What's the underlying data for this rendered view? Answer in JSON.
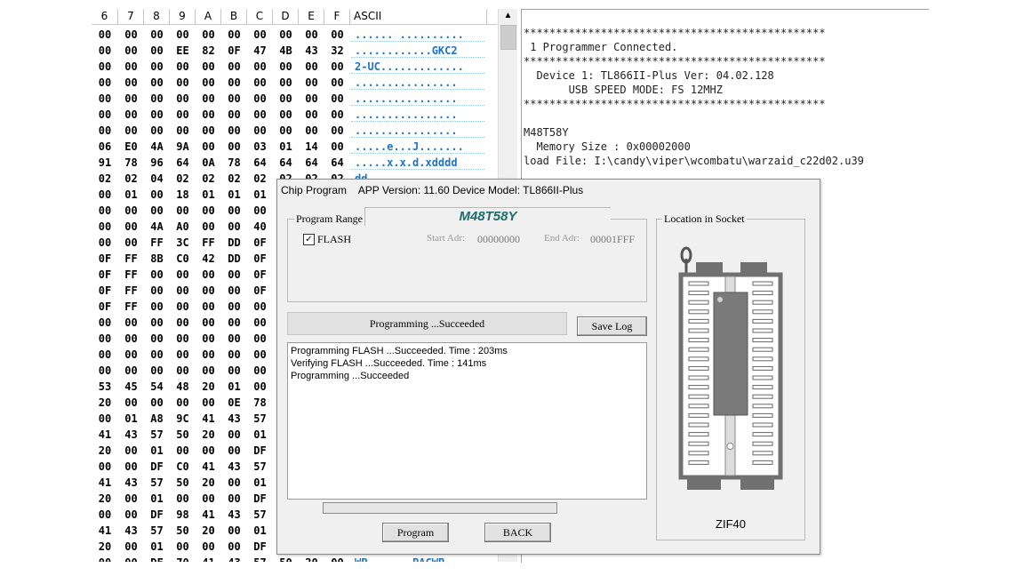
{
  "hex_view": {
    "columns": [
      "6",
      "7",
      "8",
      "9",
      "A",
      "B",
      "C",
      "D",
      "E",
      "F"
    ],
    "ascii_header": "ASCII",
    "rows": [
      {
        "cells": [
          "00",
          "00",
          "00",
          "00",
          "00",
          "00",
          "00",
          "00",
          "00",
          "00"
        ],
        "ascii": "...... .........."
      },
      {
        "cells": [
          "00",
          "00",
          "00",
          "EE",
          "82",
          "0F",
          "47",
          "4B",
          "43",
          "32"
        ],
        "ascii": "............GKC2"
      },
      {
        "cells": [
          "00",
          "00",
          "00",
          "00",
          "00",
          "00",
          "00",
          "00",
          "00",
          "00"
        ],
        "ascii": "2-UC............."
      },
      {
        "cells": [
          "00",
          "00",
          "00",
          "00",
          "00",
          "00",
          "00",
          "00",
          "00",
          "00"
        ],
        "ascii": "................"
      },
      {
        "cells": [
          "00",
          "00",
          "00",
          "00",
          "00",
          "00",
          "00",
          "00",
          "00",
          "00"
        ],
        "ascii": "................"
      },
      {
        "cells": [
          "00",
          "00",
          "00",
          "00",
          "00",
          "00",
          "00",
          "00",
          "00",
          "00"
        ],
        "ascii": "................"
      },
      {
        "cells": [
          "00",
          "00",
          "00",
          "00",
          "00",
          "00",
          "00",
          "00",
          "00",
          "00"
        ],
        "ascii": "................"
      },
      {
        "cells": [
          "06",
          "E0",
          "4A",
          "9A",
          "00",
          "00",
          "03",
          "01",
          "14",
          "00"
        ],
        "ascii": ".....e...J......."
      },
      {
        "cells": [
          "91",
          "78",
          "96",
          "64",
          "0A",
          "78",
          "64",
          "64",
          "64",
          "64"
        ],
        "ascii": ".....x.x.d.xdddd"
      },
      {
        "cells": [
          "02",
          "02",
          "04",
          "02",
          "02",
          "02",
          "02",
          "02",
          "02",
          "02"
        ],
        "ascii": "dd"
      },
      {
        "cells": [
          "00",
          "01",
          "00",
          "18",
          "01",
          "01",
          "01",
          "",
          "",
          ""
        ],
        "ascii": ""
      },
      {
        "cells": [
          "00",
          "00",
          "00",
          "00",
          "00",
          "00",
          "00",
          "",
          "",
          ""
        ],
        "ascii": ""
      },
      {
        "cells": [
          "00",
          "00",
          "4A",
          "A0",
          "00",
          "00",
          "40",
          "",
          "",
          ""
        ],
        "ascii": ""
      },
      {
        "cells": [
          "00",
          "00",
          "FF",
          "3C",
          "FF",
          "DD",
          "0F",
          "",
          "",
          ""
        ],
        "ascii": ""
      },
      {
        "cells": [
          "0F",
          "FF",
          "8B",
          "C0",
          "42",
          "DD",
          "0F",
          "",
          "",
          ""
        ],
        "ascii": ""
      },
      {
        "cells": [
          "0F",
          "FF",
          "00",
          "00",
          "00",
          "00",
          "0F",
          "",
          "",
          ""
        ],
        "ascii": ""
      },
      {
        "cells": [
          "0F",
          "FF",
          "00",
          "00",
          "00",
          "00",
          "0F",
          "",
          "",
          ""
        ],
        "ascii": ""
      },
      {
        "cells": [
          "0F",
          "FF",
          "00",
          "00",
          "00",
          "00",
          "00",
          "",
          "",
          ""
        ],
        "ascii": ""
      },
      {
        "cells": [
          "00",
          "00",
          "00",
          "00",
          "00",
          "00",
          "00",
          "",
          "",
          ""
        ],
        "ascii": ""
      },
      {
        "cells": [
          "00",
          "00",
          "00",
          "00",
          "00",
          "00",
          "00",
          "",
          "",
          ""
        ],
        "ascii": ""
      },
      {
        "cells": [
          "00",
          "00",
          "00",
          "00",
          "00",
          "00",
          "00",
          "",
          "",
          ""
        ],
        "ascii": ""
      },
      {
        "cells": [
          "00",
          "00",
          "00",
          "00",
          "00",
          "00",
          "00",
          "",
          "",
          ""
        ],
        "ascii": ""
      },
      {
        "cells": [
          "53",
          "45",
          "54",
          "48",
          "20",
          "01",
          "00",
          "",
          "",
          ""
        ],
        "ascii": ""
      },
      {
        "cells": [
          "20",
          "00",
          "00",
          "00",
          "00",
          "0E",
          "78",
          "",
          "",
          ""
        ],
        "ascii": ""
      },
      {
        "cells": [
          "00",
          "01",
          "A8",
          "9C",
          "41",
          "43",
          "57",
          "",
          "",
          ""
        ],
        "ascii": ""
      },
      {
        "cells": [
          "41",
          "43",
          "57",
          "50",
          "20",
          "00",
          "01",
          "",
          "",
          ""
        ],
        "ascii": ""
      },
      {
        "cells": [
          "20",
          "00",
          "01",
          "00",
          "00",
          "00",
          "DF",
          "",
          "",
          ""
        ],
        "ascii": ""
      },
      {
        "cells": [
          "00",
          "00",
          "DF",
          "C0",
          "41",
          "43",
          "57",
          "",
          "",
          ""
        ],
        "ascii": ""
      },
      {
        "cells": [
          "41",
          "43",
          "57",
          "50",
          "20",
          "00",
          "01",
          "",
          "",
          ""
        ],
        "ascii": ""
      },
      {
        "cells": [
          "20",
          "00",
          "01",
          "00",
          "00",
          "00",
          "DF",
          "",
          "",
          ""
        ],
        "ascii": ""
      },
      {
        "cells": [
          "00",
          "00",
          "DF",
          "98",
          "41",
          "43",
          "57",
          "",
          "",
          ""
        ],
        "ascii": ""
      },
      {
        "cells": [
          "41",
          "43",
          "57",
          "50",
          "20",
          "00",
          "01",
          "",
          "",
          ""
        ],
        "ascii": ""
      },
      {
        "cells": [
          "20",
          "00",
          "01",
          "00",
          "00",
          "00",
          "DF",
          "",
          "",
          ""
        ],
        "ascii": ""
      },
      {
        "cells": [
          "00",
          "00",
          "DF",
          "70",
          "41",
          "43",
          "57",
          "50",
          "20",
          "00"
        ],
        "ascii": "WP.......PACWP"
      }
    ]
  },
  "scrollbar": {
    "up_arrow": "▲"
  },
  "log": {
    "text": "***********************************************\n 1 Programmer Connected.\n***********************************************\n  Device 1: TL866II-Plus Ver: 04.02.128\n       USB SPEED MODE: FS 12MHZ\n***********************************************\n\nM48T58Y\n  Memory Size : 0x00002000\nload File: I:\\candy\\viper\\wcombatu\\warzaid_c22d02.u39"
  },
  "dialog": {
    "title": "Chip Program    APP Version: 11.60 Device Model: TL866II-Plus",
    "program_range_label": "Program Range",
    "chip_name": "M48T58Y",
    "flash_checked": true,
    "check_mark": "✓",
    "flash_label": "FLASH",
    "start_adr_label": "Start Adr:",
    "start_adr_value": "00000000",
    "end_adr_label": "End Adr:",
    "end_adr_value": "00001FFF",
    "status_text": "Programming  ...Succeeded",
    "save_log_label": "Save Log",
    "messages": [
      "Programming FLASH ...Succeeded. Time : 203ms",
      "Verifying FLASH ...Succeeded. Time : 141ms",
      "Programming  ...Succeeded"
    ],
    "progress": 0,
    "program_button_label": "Program",
    "back_button_label": "BACK",
    "socket_group_label": "Location in Socket",
    "socket_name": "ZIF40",
    "colors": {
      "chip_text": "#1b6e6a",
      "ascii_text": "#1d74c8",
      "progress_fill": "#06b025"
    }
  }
}
